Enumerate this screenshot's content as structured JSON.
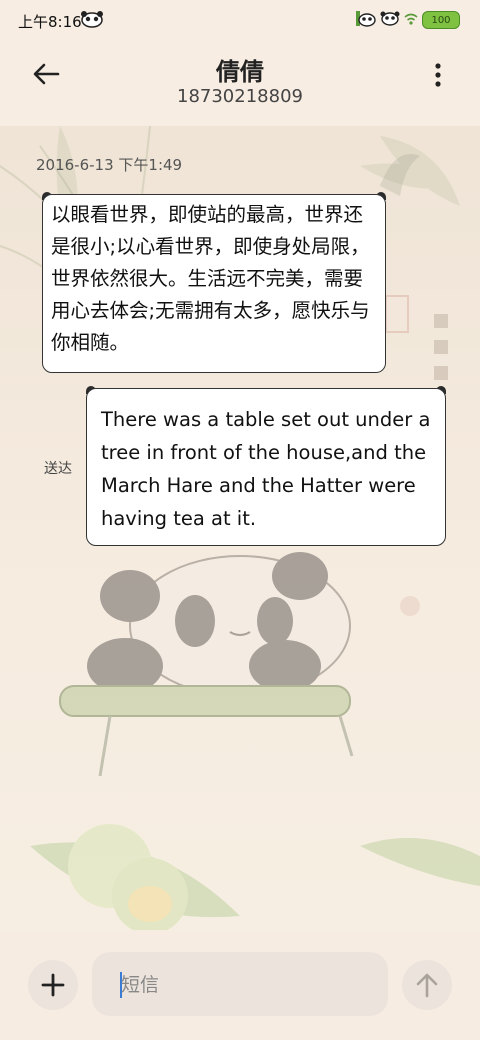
{
  "status_bar": {
    "time": "上午8:16",
    "battery": "100"
  },
  "header": {
    "contact_name": "倩倩",
    "contact_number": "18730218809"
  },
  "conversation": {
    "timestamp": "2016-6-13 下午1:49",
    "messages": [
      {
        "direction": "incoming",
        "text": "以眼看世界，即使站的最高，世界还是很小;以心看世界，即使身处局限，世界依然很大。生活远不完美，需要用心去体会;无需拥有太多，愿快乐与你相随。"
      },
      {
        "direction": "outgoing",
        "text": "There was a table set out under a tree in front of the house,and the March Hare and the Hatter were having tea at it.",
        "status": "送达"
      }
    ]
  },
  "composer": {
    "placeholder": "短信"
  },
  "colors": {
    "background": "#f7ede2",
    "bubble_fill": "#ffffff",
    "bubble_border": "#333333",
    "battery": "#7fc241",
    "caret": "#3a7bd5"
  },
  "icons": [
    "back-arrow-icon",
    "more-vertical-icon",
    "plus-icon",
    "send-arrow-up-icon",
    "panda-status-icon",
    "wifi-icon",
    "battery-icon"
  ]
}
